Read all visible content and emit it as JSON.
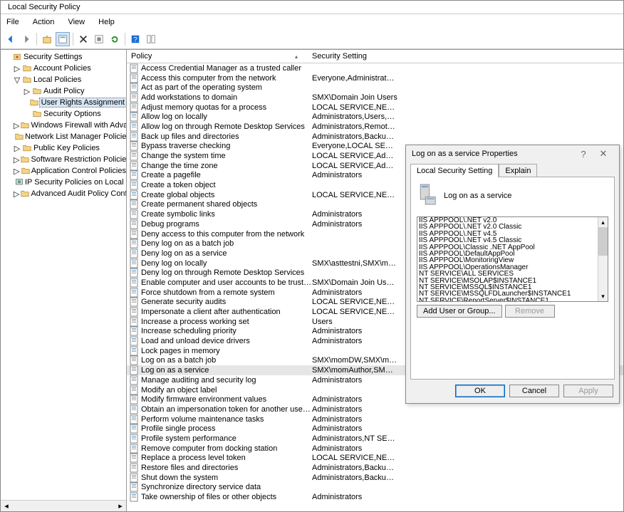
{
  "window_title": "Local Security Policy",
  "menu": [
    "File",
    "Action",
    "View",
    "Help"
  ],
  "tree_root": "Security Settings",
  "tree": [
    {
      "label": "Account Policies",
      "indent": 1,
      "tw": "▷"
    },
    {
      "label": "Local Policies",
      "indent": 1,
      "tw": "▽",
      "open": true
    },
    {
      "label": "Audit Policy",
      "indent": 2,
      "tw": "▷"
    },
    {
      "label": "User Rights Assignment",
      "indent": 2,
      "tw": "",
      "selected": true
    },
    {
      "label": "Security Options",
      "indent": 2,
      "tw": ""
    },
    {
      "label": "Windows Firewall with Advanced Sec",
      "indent": 1,
      "tw": "▷"
    },
    {
      "label": "Network List Manager Policies",
      "indent": 1,
      "tw": ""
    },
    {
      "label": "Public Key Policies",
      "indent": 1,
      "tw": "▷"
    },
    {
      "label": "Software Restriction Policies",
      "indent": 1,
      "tw": "▷"
    },
    {
      "label": "Application Control Policies",
      "indent": 1,
      "tw": "▷"
    },
    {
      "label": "IP Security Policies on Local Compute",
      "indent": 1,
      "tw": "",
      "icon": "ip"
    },
    {
      "label": "Advanced Audit Policy Configuration",
      "indent": 1,
      "tw": "▷"
    }
  ],
  "columns": {
    "policy": "Policy",
    "setting": "Security Setting"
  },
  "policies": [
    {
      "name": "Access Credential Manager as a trusted caller",
      "setting": ""
    },
    {
      "name": "Access this computer from the network",
      "setting": "Everyone,Administrators..."
    },
    {
      "name": "Act as part of the operating system",
      "setting": ""
    },
    {
      "name": "Add workstations to domain",
      "setting": "SMX\\Domain Join Users"
    },
    {
      "name": "Adjust memory quotas for a process",
      "setting": "LOCAL SERVICE,NETWO..."
    },
    {
      "name": "Allow log on locally",
      "setting": "Administrators,Users,Ba..."
    },
    {
      "name": "Allow log on through Remote Desktop Services",
      "setting": "Administrators,Remote ..."
    },
    {
      "name": "Back up files and directories",
      "setting": "Administrators,Backup ..."
    },
    {
      "name": "Bypass traverse checking",
      "setting": "Everyone,LOCAL SERVIC..."
    },
    {
      "name": "Change the system time",
      "setting": "LOCAL SERVICE,Admini..."
    },
    {
      "name": "Change the time zone",
      "setting": "LOCAL SERVICE,Admini..."
    },
    {
      "name": "Create a pagefile",
      "setting": "Administrators"
    },
    {
      "name": "Create a token object",
      "setting": ""
    },
    {
      "name": "Create global objects",
      "setting": "LOCAL SERVICE,NETWO..."
    },
    {
      "name": "Create permanent shared objects",
      "setting": ""
    },
    {
      "name": "Create symbolic links",
      "setting": "Administrators"
    },
    {
      "name": "Debug programs",
      "setting": "Administrators"
    },
    {
      "name": "Deny access to this computer from the network",
      "setting": ""
    },
    {
      "name": "Deny log on as a batch job",
      "setting": ""
    },
    {
      "name": "Deny log on as a service",
      "setting": ""
    },
    {
      "name": "Deny log on locally",
      "setting": "SMX\\asttestni,SMX\\mo..."
    },
    {
      "name": "Deny log on through Remote Desktop Services",
      "setting": ""
    },
    {
      "name": "Enable computer and user accounts to be trusted for delega...",
      "setting": "SMX\\Domain Join Users,..."
    },
    {
      "name": "Force shutdown from a remote system",
      "setting": "Administrators"
    },
    {
      "name": "Generate security audits",
      "setting": "LOCAL SERVICE,NETWO..."
    },
    {
      "name": "Impersonate a client after authentication",
      "setting": "LOCAL SERVICE,NETWO..."
    },
    {
      "name": "Increase a process working set",
      "setting": "Users"
    },
    {
      "name": "Increase scheduling priority",
      "setting": "Administrators"
    },
    {
      "name": "Load and unload device drivers",
      "setting": "Administrators"
    },
    {
      "name": "Lock pages in memory",
      "setting": ""
    },
    {
      "name": "Log on as a batch job",
      "setting": "SMX\\momDW,SMX\\mo..."
    },
    {
      "name": "Log on as a service",
      "setting": "SMX\\momAuthor,SMX\\...",
      "selected": true
    },
    {
      "name": "Manage auditing and security log",
      "setting": "Administrators"
    },
    {
      "name": "Modify an object label",
      "setting": ""
    },
    {
      "name": "Modify firmware environment values",
      "setting": "Administrators"
    },
    {
      "name": "Obtain an impersonation token for another user in the same...",
      "setting": "Administrators"
    },
    {
      "name": "Perform volume maintenance tasks",
      "setting": "Administrators"
    },
    {
      "name": "Profile single process",
      "setting": "Administrators"
    },
    {
      "name": "Profile system performance",
      "setting": "Administrators,NT SERVI..."
    },
    {
      "name": "Remove computer from docking station",
      "setting": "Administrators"
    },
    {
      "name": "Replace a process level token",
      "setting": "LOCAL SERVICE,NETWO..."
    },
    {
      "name": "Restore files and directories",
      "setting": "Administrators,Backup ..."
    },
    {
      "name": "Shut down the system",
      "setting": "Administrators,Backup ..."
    },
    {
      "name": "Synchronize directory service data",
      "setting": ""
    },
    {
      "name": "Take ownership of files or other objects",
      "setting": "Administrators"
    }
  ],
  "dialog": {
    "title": "Log on as a service Properties",
    "tabs": [
      "Local Security Setting",
      "Explain"
    ],
    "heading": "Log on as a service",
    "members": [
      "IIS APPPOOL\\.NET v2.0",
      "IIS APPPOOL\\.NET v2.0 Classic",
      "IIS APPPOOL\\.NET v4.5",
      "IIS APPPOOL\\.NET v4.5 Classic",
      "IIS APPPOOL\\Classic .NET AppPool",
      "IIS APPPOOL\\DefaultAppPool",
      "IIS APPPOOL\\MonitoringView",
      "IIS APPPOOL\\OperationsManager",
      "NT SERVICE\\ALL SERVICES",
      "NT SERVICE\\MSOLAP$INSTANCE1",
      "NT SERVICE\\MSSQL$INSTANCE1",
      "NT SERVICE\\MSSQLFDLauncher$INSTANCE1",
      "NT SERVICE\\ReportServer$INSTANCE1"
    ],
    "add_btn": "Add User or Group...",
    "remove_btn": "Remove",
    "ok": "OK",
    "cancel": "Cancel",
    "apply": "Apply"
  }
}
